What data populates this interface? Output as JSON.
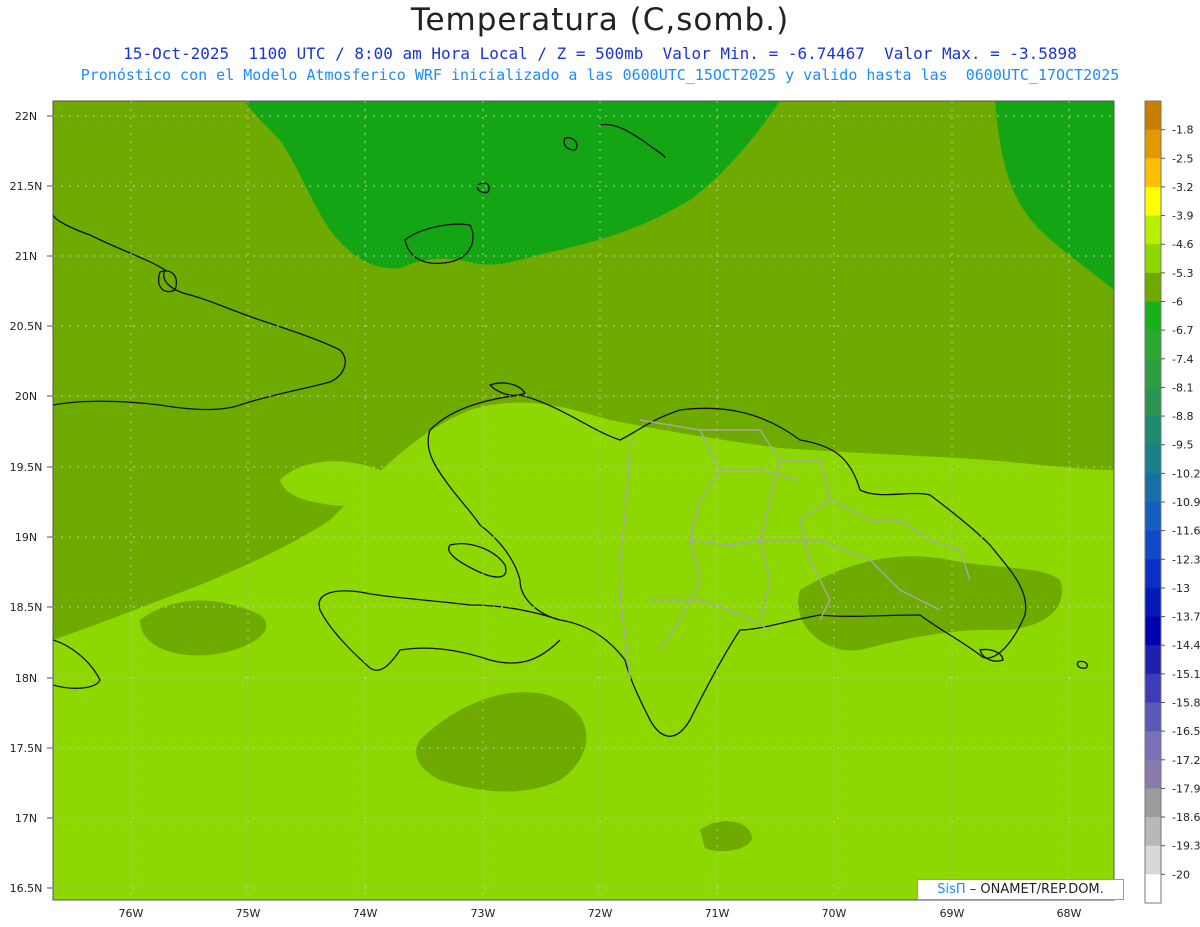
{
  "header": {
    "title": "Temperatura (C,somb.)",
    "subtitle_line1": "15-Oct-2025  1100 UTC / 8:00 am Hora Local / Z = 500mb  Valor Min. = -6.74467  Valor Max. = -3.5898",
    "subtitle_line2": "Pronóstico con el Modelo Atmosferico WRF inicializado a las 0600UTC_15OCT2025 y valido hasta las  0600UTC_17OCT2025"
  },
  "axes": {
    "lat_labels": [
      "22N",
      "21.5N",
      "21N",
      "20.5N",
      "20N",
      "19.5N",
      "19N",
      "18.5N",
      "18N",
      "17.5N",
      "17N",
      "16.5N"
    ],
    "lon_labels": [
      "76W",
      "75W",
      "74W",
      "73W",
      "72W",
      "71W",
      "70W",
      "69W",
      "68W"
    ]
  },
  "colorbar": {
    "labels": [
      "-1.8",
      "-2.5",
      "-3.2",
      "-3.9",
      "-4.6",
      "-5.3",
      "-6",
      "-6.7",
      "-7.4",
      "-8.1",
      "-8.8",
      "-9.5",
      "-10.2",
      "-10.9",
      "-11.6",
      "-12.3",
      "-13",
      "-13.7",
      "-14.4",
      "-15.1",
      "-15.8",
      "-16.5",
      "-17.2",
      "-17.9",
      "-18.6",
      "-19.3",
      "-20"
    ],
    "colors": [
      "#c67f00",
      "#e39800",
      "#ffbe00",
      "#ffff00",
      "#b8f000",
      "#8cd800",
      "#6eaa00",
      "#19b019",
      "#2aa830",
      "#2c9e40",
      "#2a9450",
      "#1f8a70",
      "#1a7f8a",
      "#1670a8",
      "#145fc0",
      "#1048c8",
      "#0a2fc4",
      "#0518b8",
      "#0000b0",
      "#2020b0",
      "#3c3cb8",
      "#5a5ab8",
      "#7a70b8",
      "#8a7ab0",
      "#9c9c9c",
      "#b8b8b8",
      "#d8d8d8",
      "#ffffff"
    ]
  },
  "fill_colors": {
    "dark_green": "#14a514",
    "mid_green": "#6eaa00",
    "light_green": "#8cd800"
  },
  "credit": {
    "brand": "SisΠ",
    "text": "– ONAMET/REP.DOM."
  }
}
